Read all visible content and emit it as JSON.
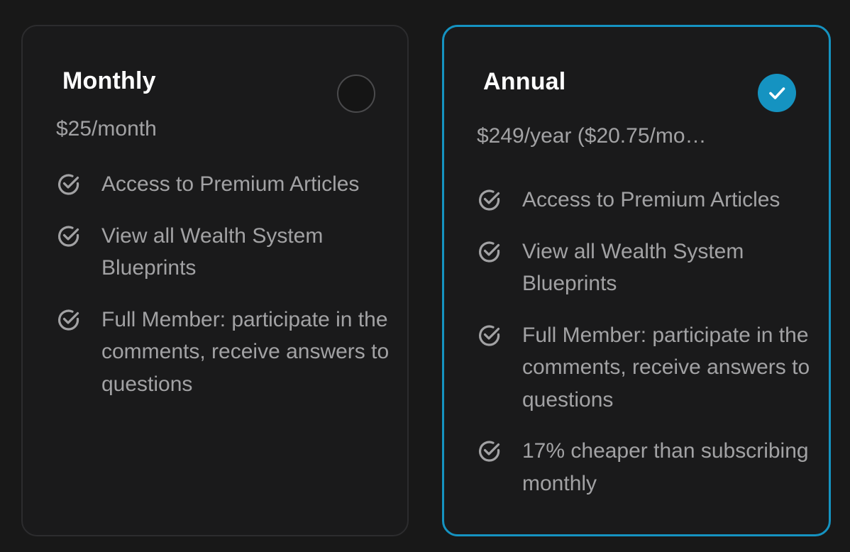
{
  "plans": [
    {
      "title": "Monthly",
      "price": "$25/month",
      "selected": false,
      "features": [
        "Access to Premium Articles",
        "View all Wealth System Blueprints",
        "Full Member: participate in the comments, receive answers to questions"
      ]
    },
    {
      "title": "Annual",
      "price": "$249/year ($20.75/mont...",
      "selected": true,
      "features": [
        "Access to Premium Articles",
        "View all Wealth System Blueprints",
        "Full Member: participate in the comments, receive answers to questions",
        "17% cheaper than subscribing monthly"
      ]
    }
  ],
  "colors": {
    "background": "#181818",
    "card_background": "#1a1a1b",
    "accent": "#1593c1",
    "text_primary": "#ffffff",
    "text_secondary": "#a2a2a4"
  },
  "icons": {
    "feature_icon": "check-circle-icon",
    "selected_icon": "checkmark-icon"
  }
}
